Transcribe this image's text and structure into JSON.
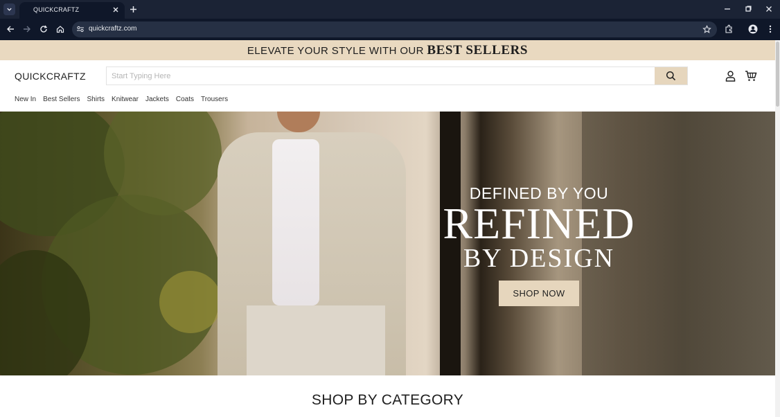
{
  "browser": {
    "tab_title": "QUICKCRAFTZ",
    "url": "quickcraftz.com"
  },
  "promo": {
    "lead": "ELEVATE YOUR STYLE WITH OUR",
    "strong": "BEST SELLERS"
  },
  "header": {
    "logo": "QUICKCRAFTZ",
    "search_placeholder": "Start Typing Here"
  },
  "menu": {
    "items": [
      "New In",
      "Best Sellers",
      "Shirts",
      "Knitwear",
      "Jackets",
      "Coats",
      "Trousers"
    ]
  },
  "hero": {
    "kicker": "DEFINED BY YOU",
    "title": "REFINED",
    "subtitle": "BY DESIGN",
    "cta": "SHOP NOW"
  },
  "sections": {
    "category_title": "SHOP BY CATEGORY"
  },
  "colors": {
    "accent_beige": "#e6d6bd",
    "browser_dark": "#0f1729"
  }
}
